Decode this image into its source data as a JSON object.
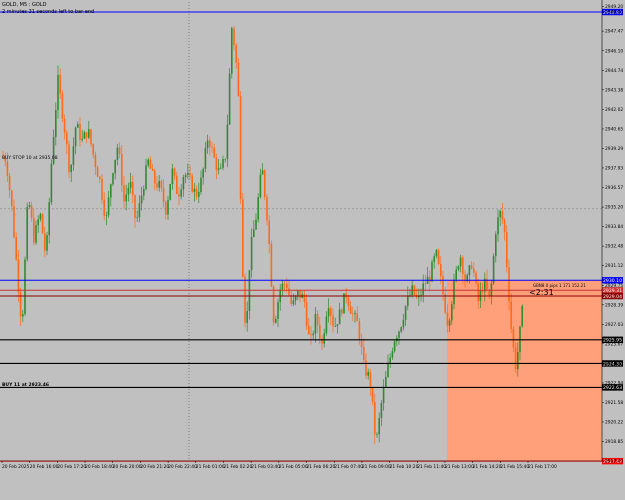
{
  "window": {
    "symbol_line": "GOLD, M5 : GOLD",
    "timer_line": "2 minutes 31 seconds left to bar end"
  },
  "countdown_label": "<2:31",
  "colors": {
    "background": "#c0c0c0",
    "bull": "#2e8b2e",
    "bear": "#ff6a1a",
    "zone": "#ffa07a",
    "blue_line": "#0000ff",
    "black_line": "#000000",
    "red_line": "#ff0000",
    "dark_red_line": "#8b0000",
    "grid": "#888888"
  },
  "chart_data": {
    "type": "candlestick",
    "ylim": [
      2917.5,
      2949.5
    ],
    "y_ticks": [
      "2949.20",
      "2948.80",
      "2947.47",
      "2946.10",
      "2944.74",
      "2943.38",
      "2942.02",
      "2940.65",
      "2939.29",
      "2937.93",
      "2936.57",
      "2935.20",
      "2933.84",
      "2932.48",
      "2931.12",
      "2929.75",
      "2928.39",
      "2927.03",
      "2925.67",
      "2924.30",
      "2922.94",
      "2921.58",
      "2920.22",
      "2918.85",
      "2917.49"
    ],
    "x_ticks": [
      "20 Feb 2025",
      "20 Feb 16:00",
      "20 Feb 17:20",
      "20 Feb 18:40",
      "20 Feb 20:00",
      "20 Feb 21:20",
      "20 Feb 22:40",
      "21 Feb 01:00",
      "21 Feb 02:20",
      "21 Feb 03:40",
      "21 Feb 05:00",
      "21 Feb 06:20",
      "21 Feb 07:40",
      "21 Feb 09:00",
      "21 Feb 10:20",
      "21 Feb 11:40",
      "21 Feb 13:00",
      "21 Feb 14:20",
      "21 Feb 15:40",
      "21 Feb 17:00"
    ],
    "close_anchors": [
      [
        0,
        2938.8
      ],
      [
        6,
        2938.6
      ],
      [
        12,
        2935.0
      ],
      [
        18,
        2930.0
      ],
      [
        22,
        2926.8
      ],
      [
        28,
        2936.0
      ],
      [
        34,
        2933.0
      ],
      [
        40,
        2934.8
      ],
      [
        46,
        2931.6
      ],
      [
        52,
        2939.0
      ],
      [
        58,
        2944.0
      ],
      [
        64,
        2941.0
      ],
      [
        70,
        2937.5
      ],
      [
        76,
        2941.0
      ],
      [
        82,
        2939.8
      ],
      [
        88,
        2940.6
      ],
      [
        94,
        2938.6
      ],
      [
        100,
        2937.0
      ],
      [
        106,
        2934.2
      ],
      [
        112,
        2937.6
      ],
      [
        118,
        2939.6
      ],
      [
        124,
        2935.6
      ],
      [
        130,
        2937.0
      ],
      [
        136,
        2934.0
      ],
      [
        142,
        2936.2
      ],
      [
        148,
        2938.4
      ],
      [
        154,
        2937.0
      ],
      [
        160,
        2936.6
      ],
      [
        166,
        2935.0
      ],
      [
        172,
        2937.8
      ],
      [
        178,
        2936.0
      ],
      [
        184,
        2937.6
      ],
      [
        190,
        2937.0
      ],
      [
        196,
        2936.0
      ],
      [
        202,
        2937.2
      ],
      [
        208,
        2940.2
      ],
      [
        214,
        2938.6
      ],
      [
        220,
        2937.4
      ],
      [
        226,
        2939.0
      ],
      [
        232,
        2948.0
      ],
      [
        238,
        2944.0
      ],
      [
        242,
        2932.0
      ],
      [
        246,
        2926.0
      ],
      [
        250,
        2932.0
      ],
      [
        256,
        2934.5
      ],
      [
        262,
        2938.0
      ],
      [
        268,
        2934.0
      ],
      [
        274,
        2927.0
      ],
      [
        280,
        2929.5
      ],
      [
        286,
        2930.0
      ],
      [
        292,
        2928.2
      ],
      [
        298,
        2929.2
      ],
      [
        304,
        2928.8
      ],
      [
        310,
        2925.5
      ],
      [
        316,
        2927.6
      ],
      [
        322,
        2925.6
      ],
      [
        328,
        2928.8
      ],
      [
        334,
        2926.8
      ],
      [
        340,
        2927.8
      ],
      [
        346,
        2929.2
      ],
      [
        352,
        2927.8
      ],
      [
        358,
        2927.0
      ],
      [
        364,
        2924.0
      ],
      [
        370,
        2923.2
      ],
      [
        376,
        2918.6
      ],
      [
        382,
        2921.8
      ],
      [
        388,
        2924.0
      ],
      [
        394,
        2926.0
      ],
      [
        400,
        2926.8
      ],
      [
        406,
        2928.4
      ],
      [
        412,
        2929.4
      ],
      [
        418,
        2928.6
      ],
      [
        424,
        2929.8
      ],
      [
        430,
        2930.4
      ],
      [
        436,
        2932.0
      ],
      [
        442,
        2929.6
      ],
      [
        448,
        2927.0
      ],
      [
        454,
        2929.8
      ],
      [
        460,
        2932.0
      ],
      [
        466,
        2929.8
      ],
      [
        472,
        2931.4
      ],
      [
        478,
        2928.6
      ],
      [
        484,
        2930.0
      ],
      [
        490,
        2928.6
      ],
      [
        496,
        2933.8
      ],
      [
        500,
        2934.8
      ],
      [
        504,
        2934.0
      ],
      [
        508,
        2930.0
      ],
      [
        512,
        2926.0
      ],
      [
        516,
        2924.0
      ],
      [
        520,
        2926.5
      ],
      [
        524,
        2929.0
      ]
    ],
    "levels": [
      {
        "price": 2948.8,
        "color": "#0000ff",
        "tag": "2948.80"
      },
      {
        "price": 2930.1,
        "color": "#0000ff",
        "tag": "2930.10"
      },
      {
        "price": 2929.4,
        "color": "#cc3333",
        "tag": "2929.31"
      },
      {
        "price": 2929.0,
        "color": "#8b0000",
        "tag": "2929.04"
      },
      {
        "price": 2925.95,
        "color": "#000000",
        "tag": "2925.95"
      },
      {
        "price": 2924.3,
        "color": "#000000",
        "tag": "2924.30"
      },
      {
        "price": 2922.63,
        "color": "#000000",
        "tag": "2922.63"
      },
      {
        "price": 2917.49,
        "color": "#ff0000",
        "tag": "2917.49"
      }
    ],
    "annotations": {
      "buy_stop": "BUY STOP 10 at 2935.08",
      "buy_limit": "BUY 11 at 2923.46",
      "order_label": "GBN8 0 pips 1 171  152.21"
    }
  }
}
